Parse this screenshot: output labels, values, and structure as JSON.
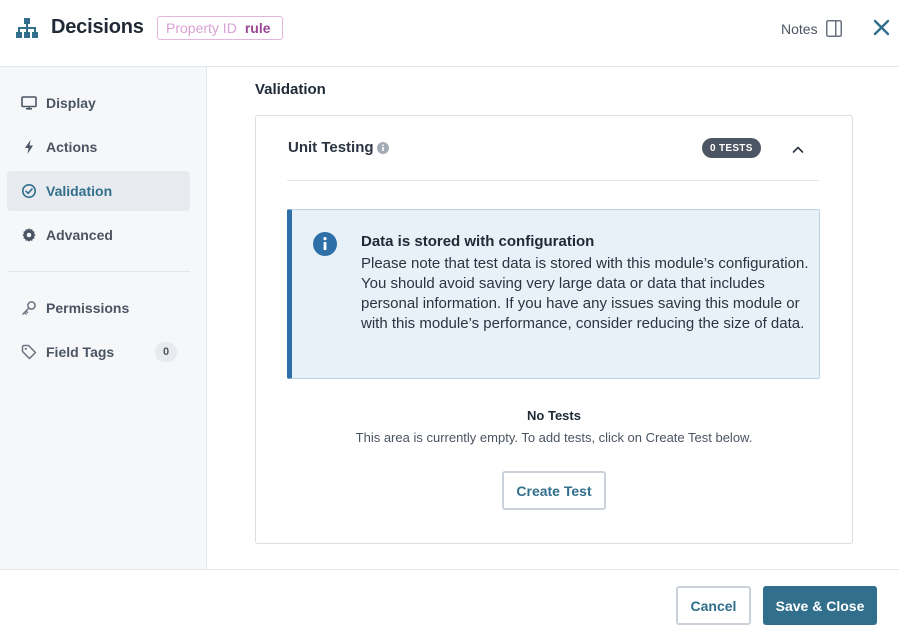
{
  "header": {
    "title": "Decisions",
    "property_id_label": "Property ID",
    "property_id_value": "rule",
    "notes_label": "Notes",
    "app_icon": "hierarchy-icon",
    "close_icon": "close-icon"
  },
  "sidebar": {
    "items": [
      {
        "label": "Display",
        "icon": "monitor-icon"
      },
      {
        "label": "Actions",
        "icon": "lightning-icon"
      },
      {
        "label": "Validation",
        "icon": "check-circle-icon",
        "active": true
      },
      {
        "label": "Advanced",
        "icon": "gear-icon"
      },
      {
        "label": "Permissions",
        "icon": "key-icon"
      },
      {
        "label": "Field Tags",
        "icon": "tag-icon",
        "count": "0"
      }
    ]
  },
  "main": {
    "section_title": "Validation",
    "unit_testing": {
      "title": "Unit Testing",
      "tests_badge": "0 TESTS",
      "callout": {
        "title": "Data is stored with configuration",
        "body": "Please note that test data is stored with this module’s configuration. You should avoid saving very large data or data that includes personal information. If you have any issues saving this module or with this module’s performance, consider reducing the size of data."
      },
      "empty_title": "No Tests",
      "empty_description": "This area is currently empty. To add tests, click on Create Test below.",
      "create_button": "Create Test"
    }
  },
  "footer": {
    "cancel_label": "Cancel",
    "save_label": "Save & Close"
  },
  "colors": {
    "primary": "#316f8c",
    "callout_bg": "#e8f1f8",
    "callout_border": "#2f6fa8",
    "badge_bg": "#4b5563",
    "property_badge_text": "#9b4794"
  }
}
